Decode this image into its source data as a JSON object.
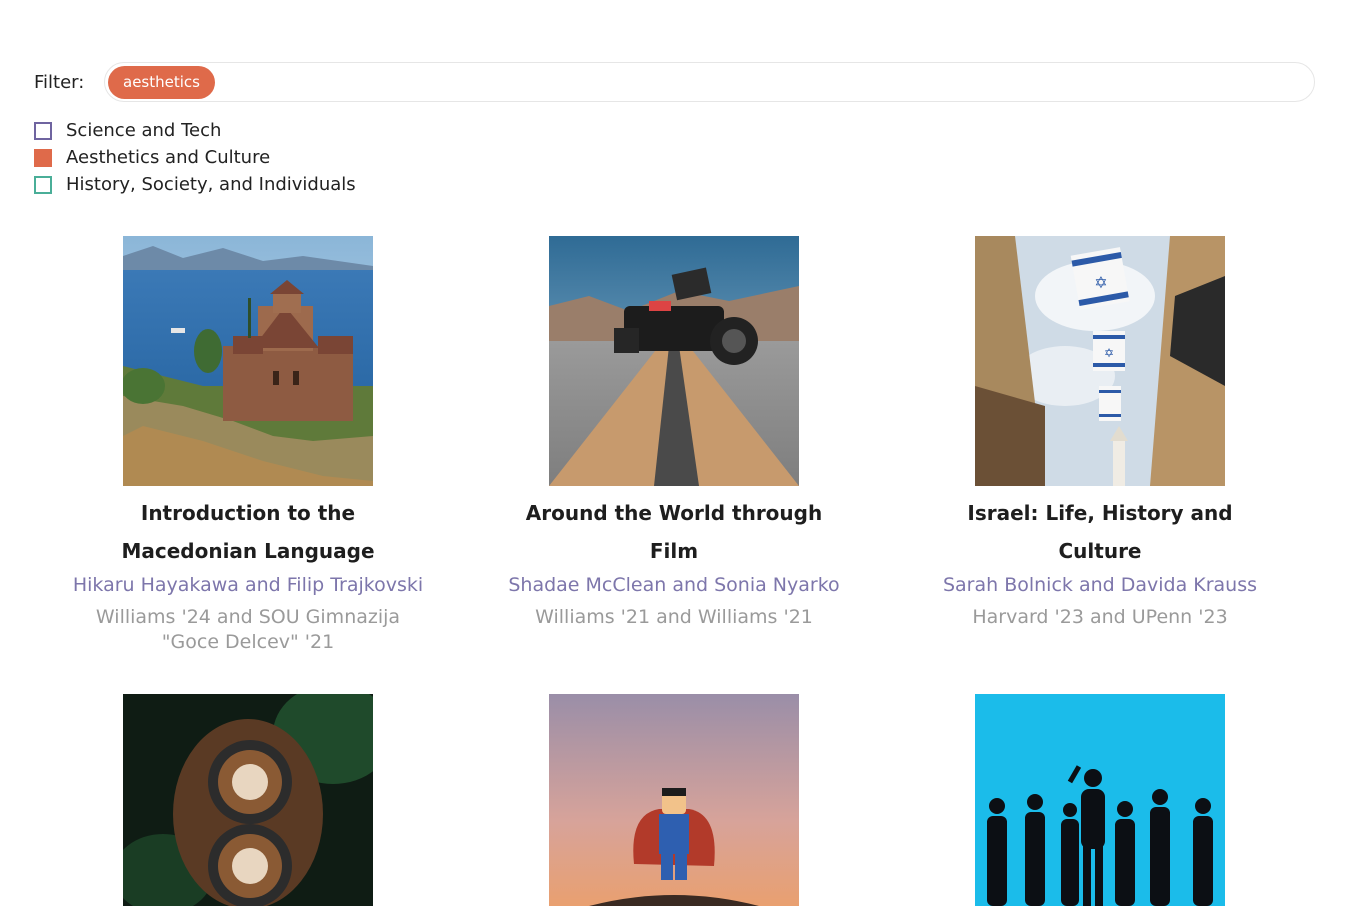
{
  "filter": {
    "label": "Filter:",
    "chip": "aesthetics"
  },
  "legend": [
    {
      "label": "Science and Tech",
      "color": "#6f64a0"
    },
    {
      "label": "Aesthetics and Culture",
      "color": "#df6a4a"
    },
    {
      "label": "History, Society, and Individuals",
      "color": "#4aae98"
    }
  ],
  "courses": [
    {
      "title": "Introduction to the Macedonian Language",
      "authors": "Hikaru Hayakawa and Filip Trajkovski",
      "schools": "Williams '24 and SOU Gimnazija \"Goce Delcev\" '21"
    },
    {
      "title": "Around the World through Film",
      "authors": "Shadae McClean and Sonia Nyarko",
      "schools": "Williams '21 and Williams '21"
    },
    {
      "title": "Israel: Life, History and Culture",
      "authors": "Sarah Bolnick and Davida Krauss",
      "schools": "Harvard '23 and UPenn '23"
    },
    {
      "title": "",
      "authors": "",
      "schools": ""
    },
    {
      "title": "",
      "authors": "",
      "schools": ""
    },
    {
      "title": "",
      "authors": "",
      "schools": ""
    }
  ]
}
